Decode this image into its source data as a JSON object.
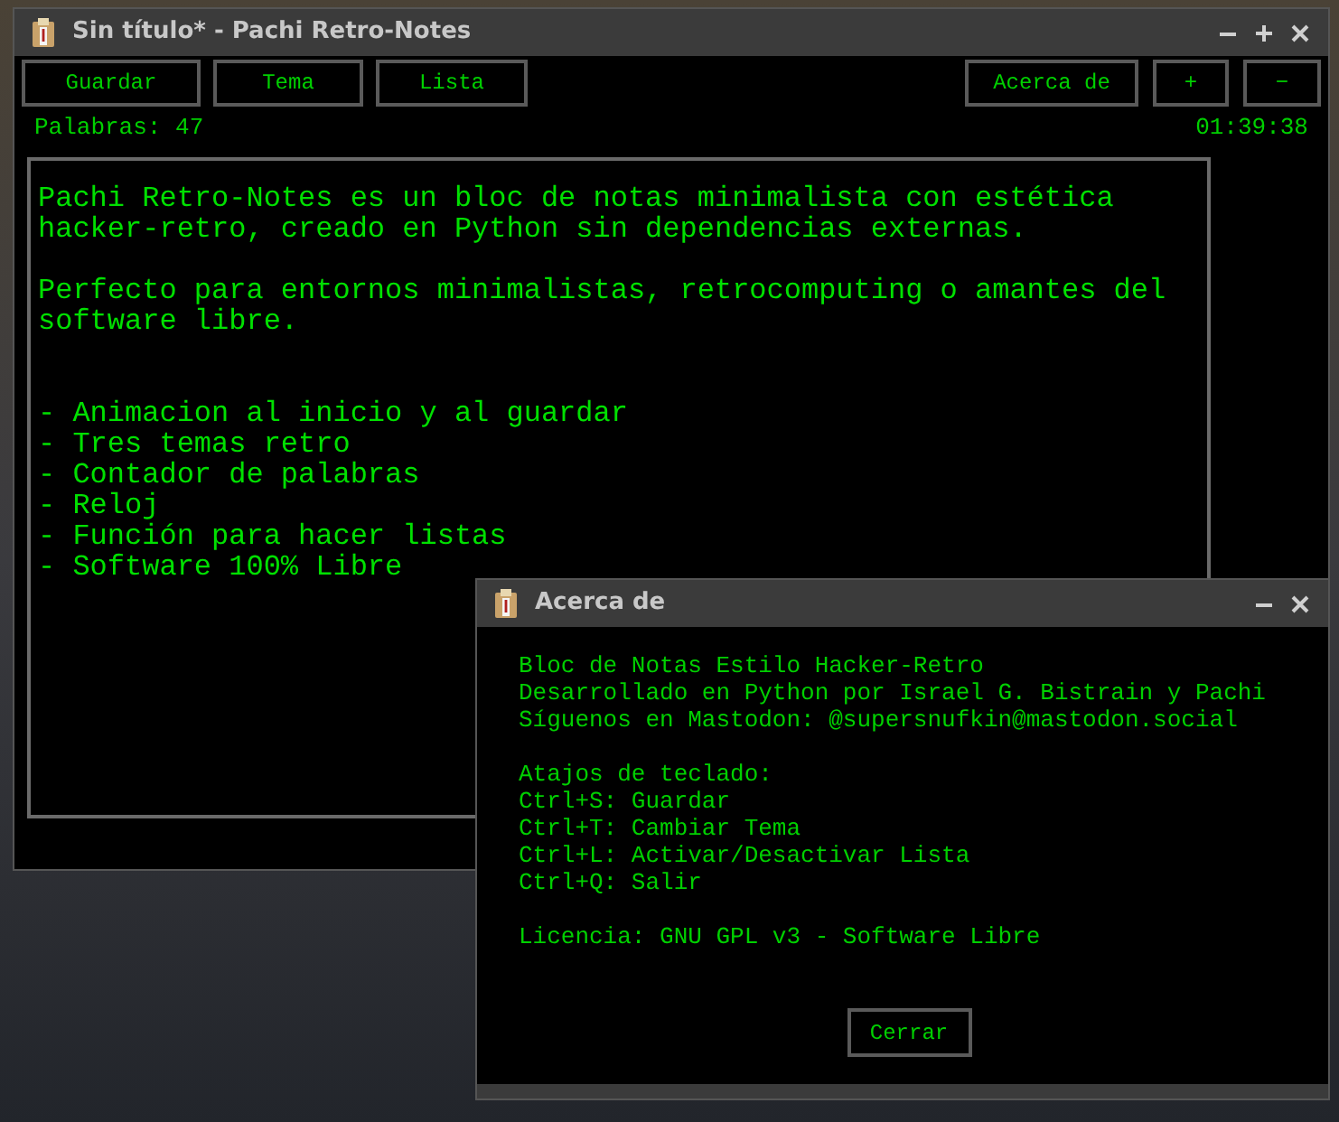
{
  "main_window": {
    "title": "Sin título* - Pachi Retro-Notes",
    "toolbar_left": [
      "Guardar",
      "Tema",
      "Lista"
    ],
    "toolbar_right": [
      "Acerca de",
      "+",
      "−"
    ],
    "word_count": "Palabras: 47",
    "clock": "01:39:38",
    "editor_text": "Pachi Retro-Notes es un bloc de notas minimalista con estética\nhacker-retro, creado en Python sin dependencias externas.\n\nPerfecto para entornos minimalistas, retrocomputing o amantes del\nsoftware libre.\n\n\n- Animacion al inicio y al guardar\n- Tres temas retro\n- Contador de palabras\n- Reloj\n- Función para hacer listas\n- Software 100% Libre"
  },
  "about_dialog": {
    "title": "Acerca de",
    "groups": [
      [
        "Bloc de Notas Estilo Hacker-Retro",
        "Desarrollado en Python por Israel G. Bistrain y Pachi",
        "Síguenos en Mastodon: @supersnufkin@mastodon.social"
      ],
      [
        "Atajos de teclado:",
        "Ctrl+S: Guardar",
        "Ctrl+T: Cambiar Tema",
        "Ctrl+L: Activar/Desactivar Lista",
        "Ctrl+Q: Salir"
      ],
      [
        "Licencia: GNU GPL v3 - Software Libre"
      ]
    ],
    "button": "Cerrar"
  }
}
